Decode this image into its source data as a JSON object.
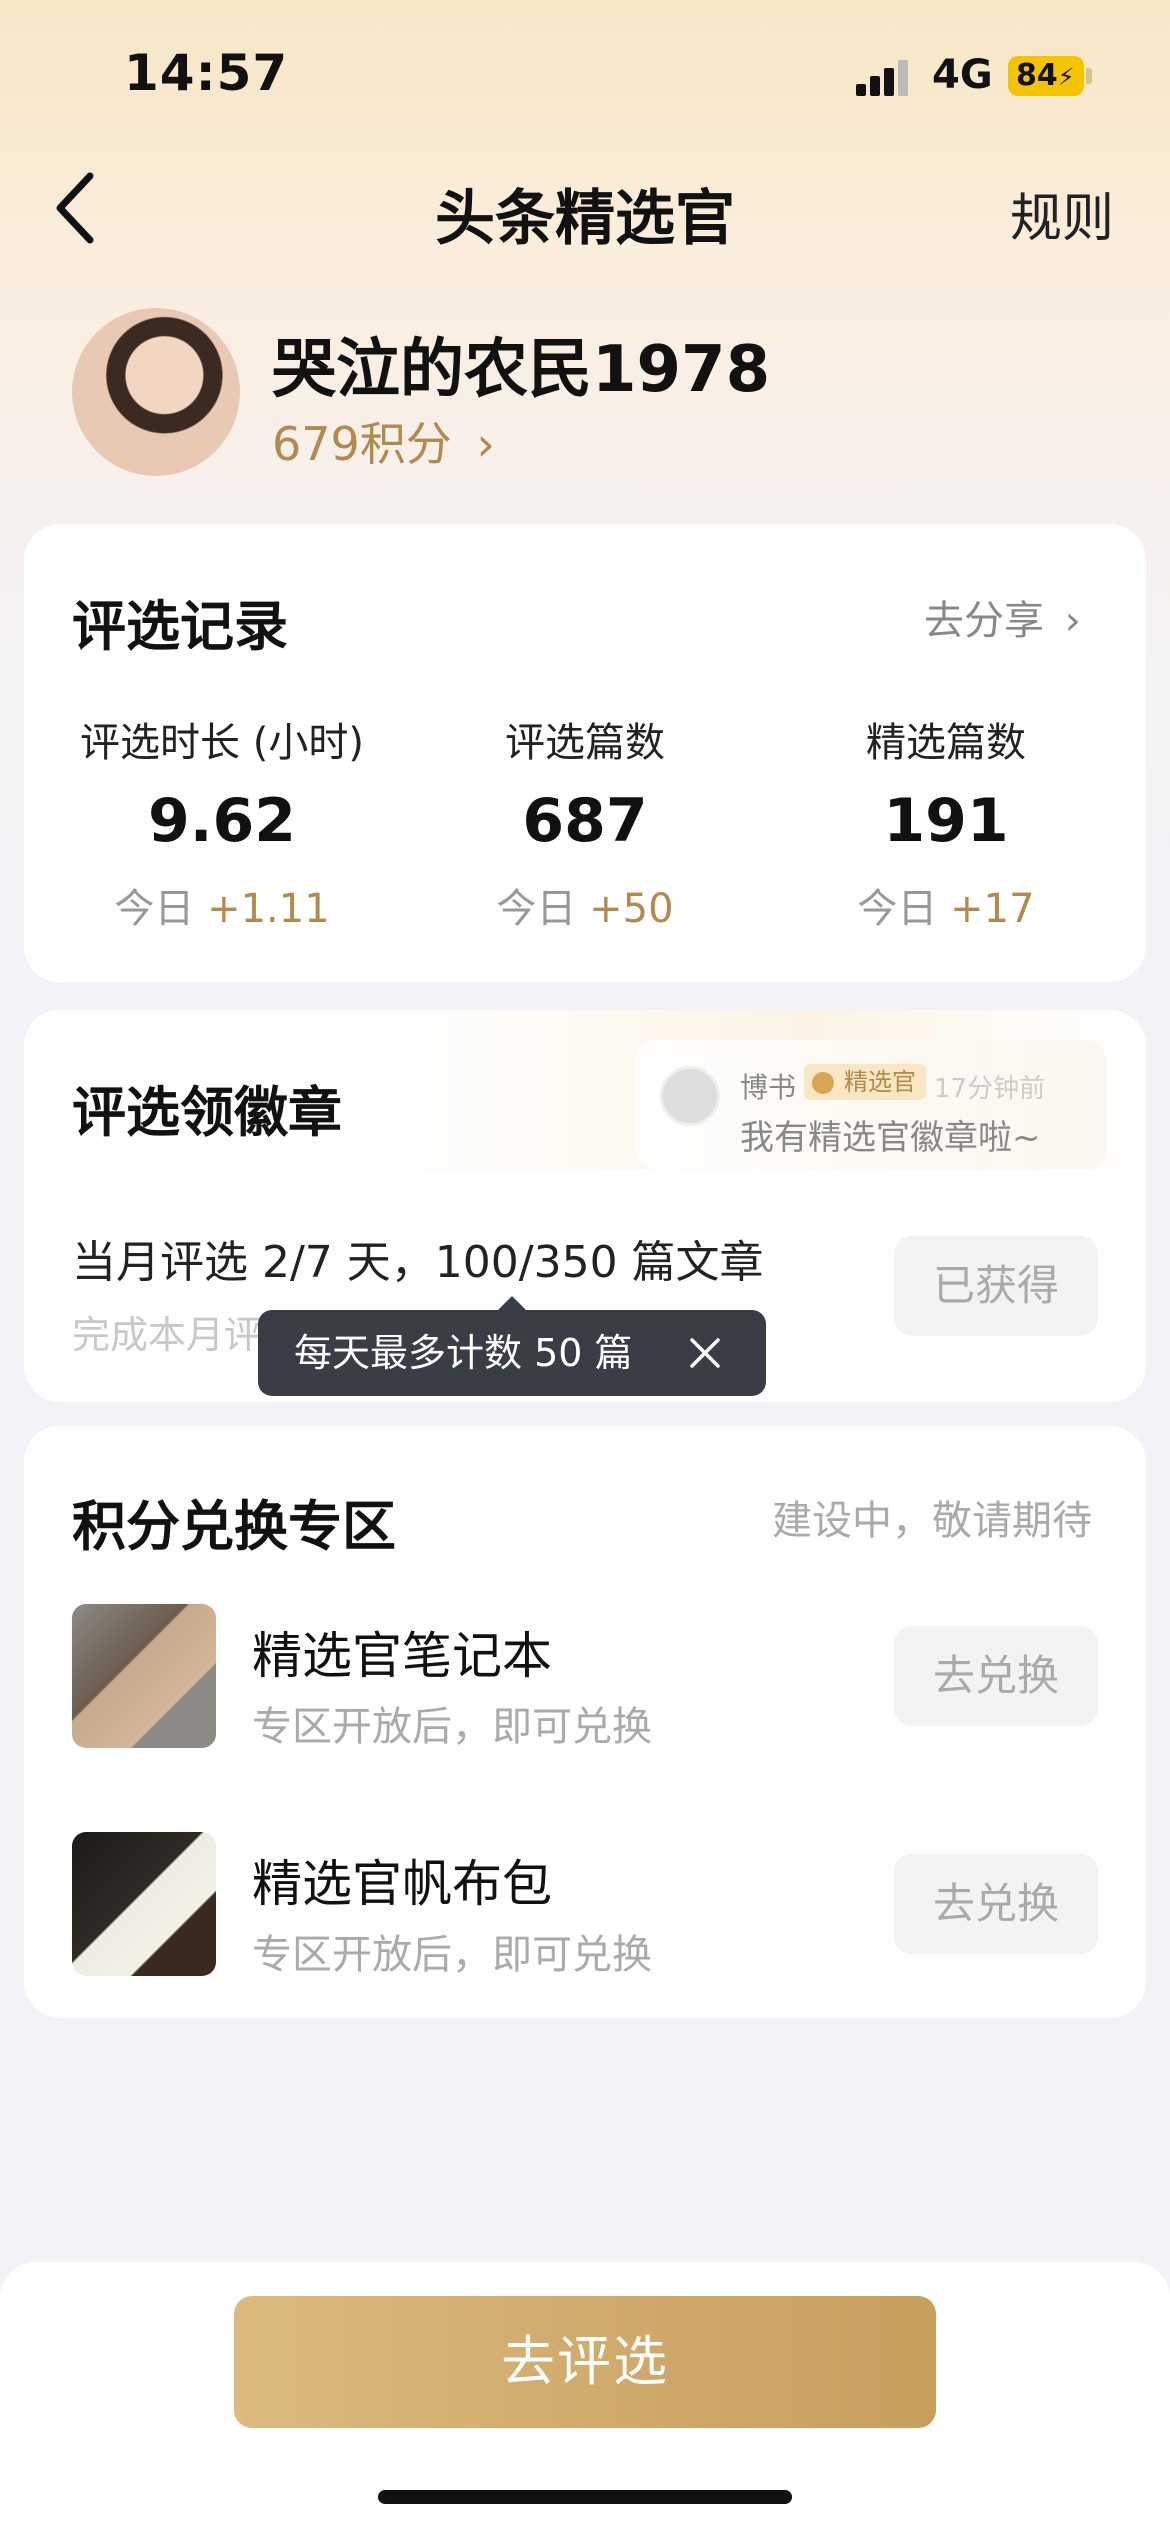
{
  "status_bar": {
    "time": "14:57",
    "network": "4G",
    "battery": "84"
  },
  "nav": {
    "title": "头条精选官",
    "rules_label": "规则"
  },
  "profile": {
    "username": "哭泣的农民1978",
    "points": "679积分",
    "points_chevron": "›"
  },
  "record": {
    "title": "评选记录",
    "share_label": "去分享",
    "share_chevron": "›",
    "stats": [
      {
        "label": "评选时长 (小时)",
        "value": "9.62",
        "today_prefix": "今日",
        "today_delta": "+1.11"
      },
      {
        "label": "评选篇数",
        "value": "687",
        "today_prefix": "今日",
        "today_delta": "+50"
      },
      {
        "label": "精选篇数",
        "value": "191",
        "today_prefix": "今日",
        "today_delta": "+17"
      }
    ]
  },
  "badge": {
    "title": "评选领徽章",
    "bubble": {
      "name": "博书",
      "badge": "精选官",
      "time": "17分钟前",
      "text": "我有精选官徽章啦~"
    },
    "monthly_text": "当月评选 2/7 天，100/350 篇文章",
    "monthly_sub": "完成本月评选量，获精选官徽章",
    "button_label": "已获得",
    "tooltip": "每天最多计数 50 篇"
  },
  "exchange": {
    "title": "积分兑换专区",
    "status": "建设中，敬请期待",
    "items": [
      {
        "name": "精选官笔记本",
        "sub": "专区开放后，即可兑换",
        "button": "去兑换"
      },
      {
        "name": "精选官帆布包",
        "sub": "专区开放后，即可兑换",
        "button": "去兑换"
      }
    ]
  },
  "cta": {
    "label": "去评选"
  },
  "colors": {
    "accent_gold": "#b18a4e",
    "cta_gradient": [
      "#dcb97e",
      "#c79e5c"
    ],
    "tooltip_bg": "#3a3d45",
    "battery": "#f5c400"
  }
}
